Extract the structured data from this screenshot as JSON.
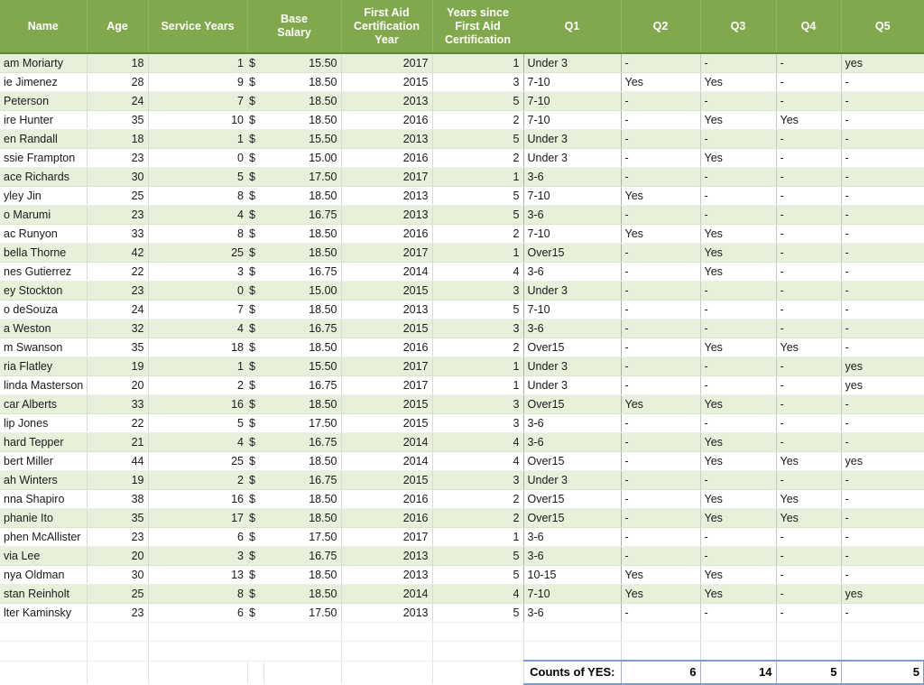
{
  "sheet": {
    "title": "Employee data worksheet",
    "header_bg": "#82a84e",
    "stripe_color": "#e8f0da",
    "selection_border": "#7a9bd4"
  },
  "columns": [
    {
      "key": "name",
      "label": "Name"
    },
    {
      "key": "age",
      "label": "Age"
    },
    {
      "key": "serv",
      "label": "Service Years"
    },
    {
      "key": "sal",
      "label": "Base\nSalary"
    },
    {
      "key": "cert",
      "label": "First Aid\nCertification\nYear"
    },
    {
      "key": "since",
      "label": "Years since\nFirst Aid\nCertification"
    },
    {
      "key": "q1",
      "label": "Q1"
    },
    {
      "key": "q2",
      "label": "Q2"
    },
    {
      "key": "q3",
      "label": "Q3"
    },
    {
      "key": "q4",
      "label": "Q4"
    },
    {
      "key": "q5",
      "label": "Q5"
    }
  ],
  "header_labels": {
    "name": "Name",
    "age": "Age",
    "serv": "Service Years",
    "sal_line1": "Base",
    "sal_line2": "Salary",
    "cert_line1": "First Aid",
    "cert_line2": "Certification",
    "cert_line3": "Year",
    "since_line1": "Years since",
    "since_line2": "First Aid",
    "since_line3": "Certification",
    "q1": "Q1",
    "q2": "Q2",
    "q3": "Q3",
    "q4": "Q4",
    "q5": "Q5"
  },
  "currency_symbol": "$",
  "rows": [
    {
      "name": "am Moriarty",
      "age": "18",
      "serv": "1",
      "cur": "$",
      "sal": "15.50",
      "cert": "2017",
      "since": "1",
      "q1": "Under 3",
      "q2": "-",
      "q3": "-",
      "q4": "-",
      "q5": "yes"
    },
    {
      "name": "ie Jimenez",
      "age": "28",
      "serv": "9",
      "cur": "$",
      "sal": "18.50",
      "cert": "2015",
      "since": "3",
      "q1": "7-10",
      "q2": "Yes",
      "q3": "Yes",
      "q4": "-",
      "q5": "-"
    },
    {
      "name": " Peterson",
      "age": "24",
      "serv": "7",
      "cur": "$",
      "sal": "18.50",
      "cert": "2013",
      "since": "5",
      "q1": "7-10",
      "q2": "-",
      "q3": "-",
      "q4": "-",
      "q5": "-"
    },
    {
      "name": "ire Hunter",
      "age": "35",
      "serv": "10",
      "cur": "$",
      "sal": "18.50",
      "cert": "2016",
      "since": "2",
      "q1": "7-10",
      "q2": "-",
      "q3": "Yes",
      "q4": "Yes",
      "q5": "-"
    },
    {
      "name": "en Randall",
      "age": "18",
      "serv": "1",
      "cur": "$",
      "sal": "15.50",
      "cert": "2013",
      "since": "5",
      "q1": "Under 3",
      "q2": "-",
      "q3": "-",
      "q4": "-",
      "q5": "-"
    },
    {
      "name": "ssie Frampton",
      "age": "23",
      "serv": "0",
      "cur": "$",
      "sal": "15.00",
      "cert": "2016",
      "since": "2",
      "q1": "Under 3",
      "q2": "-",
      "q3": "Yes",
      "q4": "-",
      "q5": "-"
    },
    {
      "name": "ace Richards",
      "age": "30",
      "serv": "5",
      "cur": "$",
      "sal": "17.50",
      "cert": "2017",
      "since": "1",
      "q1": "3-6",
      "q2": "-",
      "q3": "-",
      "q4": "-",
      "q5": "-"
    },
    {
      "name": "yley Jin",
      "age": "25",
      "serv": "8",
      "cur": "$",
      "sal": "18.50",
      "cert": "2013",
      "since": "5",
      "q1": "7-10",
      "q2": "Yes",
      "q3": "-",
      "q4": "-",
      "q5": "-"
    },
    {
      "name": "o Marumi",
      "age": "23",
      "serv": "4",
      "cur": "$",
      "sal": "16.75",
      "cert": "2013",
      "since": "5",
      "q1": "3-6",
      "q2": "-",
      "q3": "-",
      "q4": "-",
      "q5": "-"
    },
    {
      "name": "ac Runyon",
      "age": "33",
      "serv": "8",
      "cur": "$",
      "sal": "18.50",
      "cert": "2016",
      "since": "2",
      "q1": "7-10",
      "q2": "Yes",
      "q3": "Yes",
      "q4": "-",
      "q5": "-"
    },
    {
      "name": "bella Thorne",
      "age": "42",
      "serv": "25",
      "cur": "$",
      "sal": "18.50",
      "cert": "2017",
      "since": "1",
      "q1": "Over15",
      "q2": "-",
      "q3": "Yes",
      "q4": "-",
      "q5": "-"
    },
    {
      "name": "nes Gutierrez",
      "age": "22",
      "serv": "3",
      "cur": "$",
      "sal": "16.75",
      "cert": "2014",
      "since": "4",
      "q1": "3-6",
      "q2": "-",
      "q3": "Yes",
      "q4": "-",
      "q5": "-"
    },
    {
      "name": "ey Stockton",
      "age": "23",
      "serv": "0",
      "cur": "$",
      "sal": "15.00",
      "cert": "2015",
      "since": "3",
      "q1": "Under 3",
      "q2": "-",
      "q3": "-",
      "q4": "-",
      "q5": "-"
    },
    {
      "name": "o deSouza",
      "age": "24",
      "serv": "7",
      "cur": "$",
      "sal": "18.50",
      "cert": "2013",
      "since": "5",
      "q1": "7-10",
      "q2": "-",
      "q3": "-",
      "q4": "-",
      "q5": "-"
    },
    {
      "name": "a Weston",
      "age": "32",
      "serv": "4",
      "cur": "$",
      "sal": "16.75",
      "cert": "2015",
      "since": "3",
      "q1": "3-6",
      "q2": "-",
      "q3": "-",
      "q4": "-",
      "q5": "-"
    },
    {
      "name": "m Swanson",
      "age": "35",
      "serv": "18",
      "cur": "$",
      "sal": "18.50",
      "cert": "2016",
      "since": "2",
      "q1": "Over15",
      "q2": "-",
      "q3": "Yes",
      "q4": "Yes",
      "q5": "-"
    },
    {
      "name": "ria Flatley",
      "age": "19",
      "serv": "1",
      "cur": "$",
      "sal": "15.50",
      "cert": "2017",
      "since": "1",
      "q1": "Under 3",
      "q2": "-",
      "q3": "-",
      "q4": "-",
      "q5": "yes"
    },
    {
      "name": "linda Masterson",
      "age": "20",
      "serv": "2",
      "cur": "$",
      "sal": "16.75",
      "cert": "2017",
      "since": "1",
      "q1": "Under 3",
      "q2": "-",
      "q3": "-",
      "q4": "-",
      "q5": "yes"
    },
    {
      "name": "car Alberts",
      "age": "33",
      "serv": "16",
      "cur": "$",
      "sal": "18.50",
      "cert": "2015",
      "since": "3",
      "q1": "Over15",
      "q2": "Yes",
      "q3": "Yes",
      "q4": "-",
      "q5": "-"
    },
    {
      "name": "lip Jones",
      "age": "22",
      "serv": "5",
      "cur": "$",
      "sal": "17.50",
      "cert": "2015",
      "since": "3",
      "q1": "3-6",
      "q2": "-",
      "q3": "-",
      "q4": "-",
      "q5": "-"
    },
    {
      "name": "hard Tepper",
      "age": "21",
      "serv": "4",
      "cur": "$",
      "sal": "16.75",
      "cert": "2014",
      "since": "4",
      "q1": "3-6",
      "q2": "-",
      "q3": "Yes",
      "q4": "-",
      "q5": "-"
    },
    {
      "name": "bert Miller",
      "age": "44",
      "serv": "25",
      "cur": "$",
      "sal": "18.50",
      "cert": "2014",
      "since": "4",
      "q1": "Over15",
      "q2": "-",
      "q3": "Yes",
      "q4": "Yes",
      "q5": "yes"
    },
    {
      "name": "ah Winters",
      "age": "19",
      "serv": "2",
      "cur": "$",
      "sal": "16.75",
      "cert": "2015",
      "since": "3",
      "q1": "Under 3",
      "q2": "-",
      "q3": "-",
      "q4": "-",
      "q5": "-"
    },
    {
      "name": "nna Shapiro",
      "age": "38",
      "serv": "16",
      "cur": "$",
      "sal": "18.50",
      "cert": "2016",
      "since": "2",
      "q1": "Over15",
      "q2": "-",
      "q3": "Yes",
      "q4": "Yes",
      "q5": "-"
    },
    {
      "name": "phanie Ito",
      "age": "35",
      "serv": "17",
      "cur": "$",
      "sal": "18.50",
      "cert": "2016",
      "since": "2",
      "q1": "Over15",
      "q2": "-",
      "q3": "Yes",
      "q4": "Yes",
      "q5": "-"
    },
    {
      "name": "phen McAllister",
      "age": "23",
      "serv": "6",
      "cur": "$",
      "sal": "17.50",
      "cert": "2017",
      "since": "1",
      "q1": "3-6",
      "q2": "-",
      "q3": "-",
      "q4": "-",
      "q5": "-"
    },
    {
      "name": "via Lee",
      "age": "20",
      "serv": "3",
      "cur": "$",
      "sal": "16.75",
      "cert": "2013",
      "since": "5",
      "q1": "3-6",
      "q2": "-",
      "q3": "-",
      "q4": "-",
      "q5": "-"
    },
    {
      "name": "nya Oldman",
      "age": "30",
      "serv": "13",
      "cur": "$",
      "sal": "18.50",
      "cert": "2013",
      "since": "5",
      "q1": "10-15",
      "q2": "Yes",
      "q3": "Yes",
      "q4": "-",
      "q5": "-"
    },
    {
      "name": "stan Reinholt",
      "age": "25",
      "serv": "8",
      "cur": "$",
      "sal": "18.50",
      "cert": "2014",
      "since": "4",
      "q1": "7-10",
      "q2": "Yes",
      "q3": "Yes",
      "q4": "-",
      "q5": "yes"
    },
    {
      "name": "lter Kaminsky",
      "age": "23",
      "serv": "6",
      "cur": "$",
      "sal": "17.50",
      "cert": "2013",
      "since": "5",
      "q1": "3-6",
      "q2": "-",
      "q3": "-",
      "q4": "-",
      "q5": "-"
    }
  ],
  "totals": {
    "label": "Counts of YES:",
    "q2": "6",
    "q3": "14",
    "q4": "5",
    "q5": "5"
  }
}
